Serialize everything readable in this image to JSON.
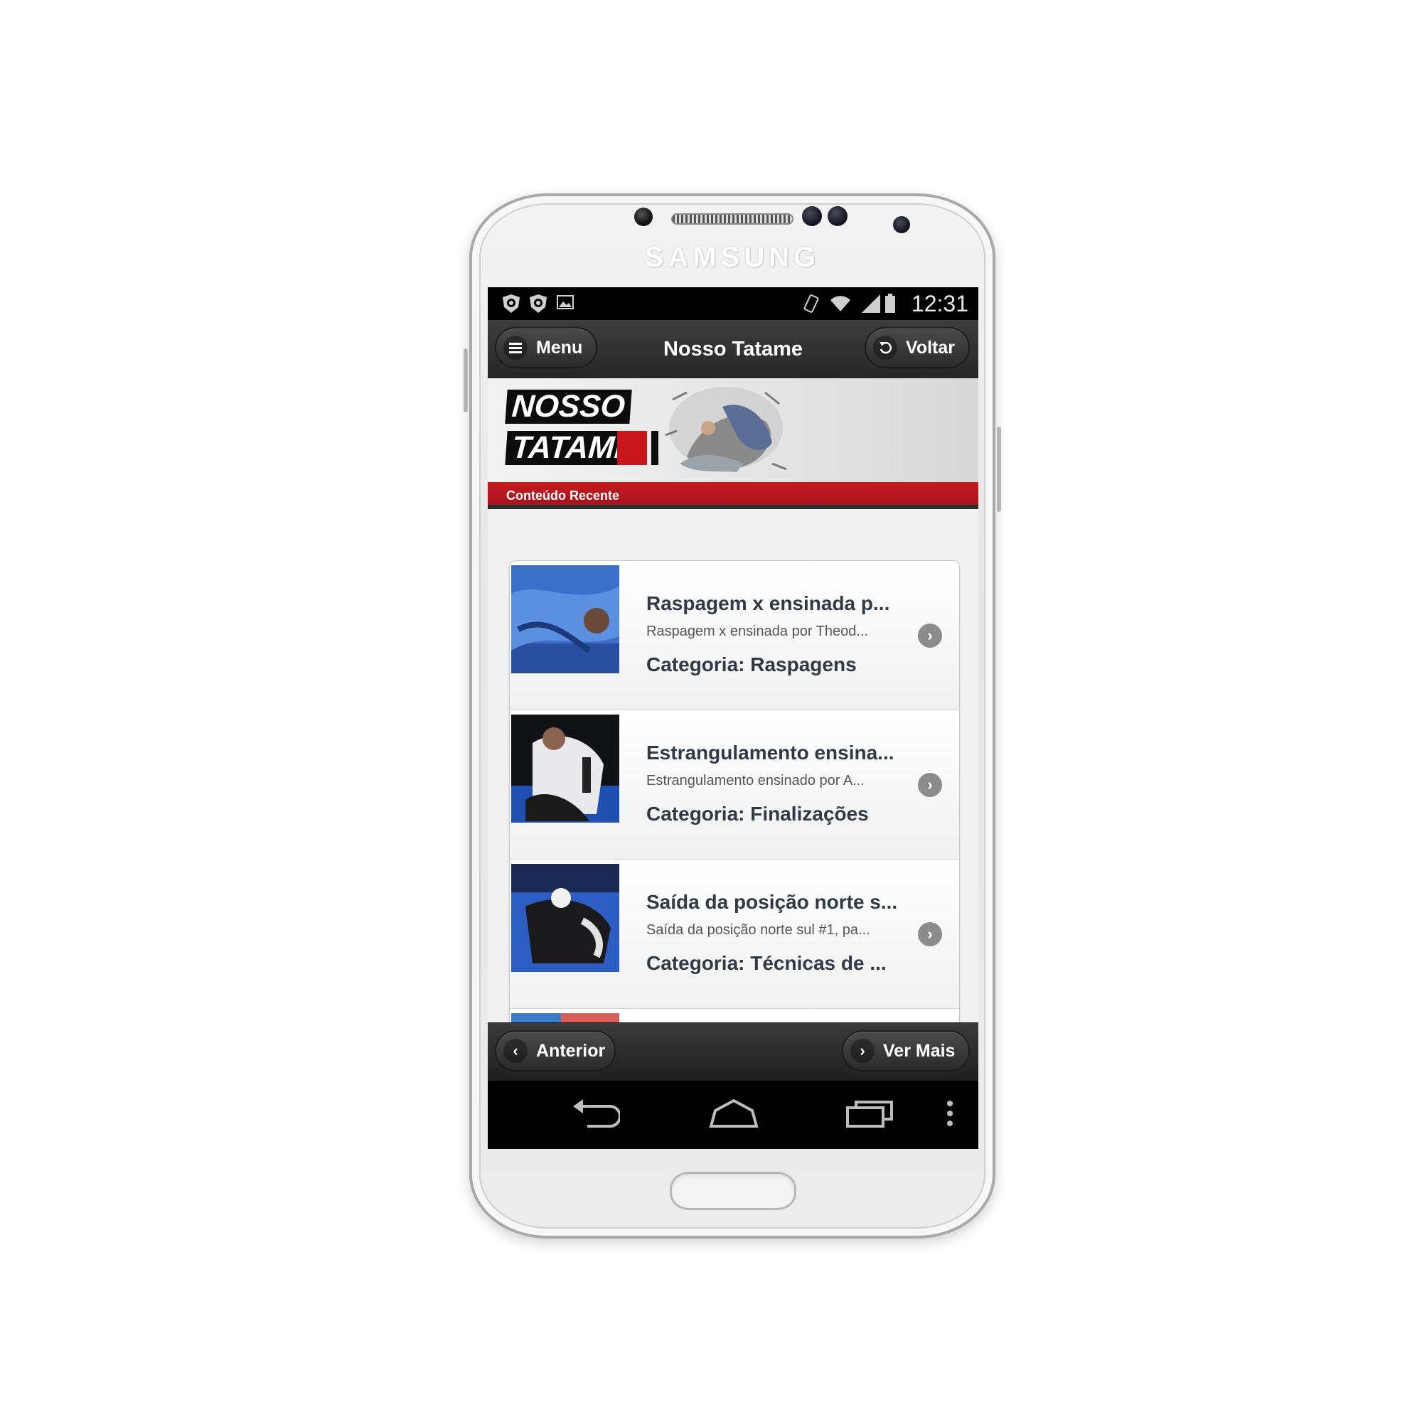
{
  "device": {
    "brand": "SAMSUNG"
  },
  "statusbar": {
    "time": "12:31",
    "icons": [
      "shield-icon",
      "shield-icon",
      "image-icon",
      "vibrate-icon",
      "wifi-icon",
      "signal-icon",
      "battery-icon"
    ]
  },
  "appbar": {
    "menu_label": "Menu",
    "title": "Nosso Tatame",
    "back_label": "Voltar"
  },
  "banner": {
    "logo_line1": "NOSSO",
    "logo_line2": "TATAME",
    "section_label": "Conteúdo Recente",
    "accent_color": "#c51c22"
  },
  "items": [
    {
      "title": "Raspagem x ensinada p...",
      "description": "Raspagem x ensinada por Theod...",
      "category": "Categoria: Raspagens"
    },
    {
      "title": "Estrangulamento ensina...",
      "description": "Estrangulamento ensinado por A...",
      "category": "Categoria: Finalizações"
    },
    {
      "title": "Saída da posição norte s...",
      "description": "Saída da posição norte sul #1, pa...",
      "category": "Categoria: Técnicas de ..."
    }
  ],
  "footer": {
    "prev_label": "Anterior",
    "next_label": "Ver Mais"
  },
  "navbar": {
    "icons": [
      "back-icon",
      "home-icon",
      "recent-apps-icon",
      "overflow-menu-icon"
    ]
  }
}
